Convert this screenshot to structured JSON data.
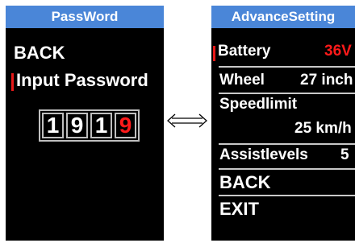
{
  "password_screen": {
    "title": "PassWord",
    "back_label": "BACK",
    "input_label": "Input Password",
    "digits": [
      "1",
      "9",
      "1",
      "9"
    ]
  },
  "connector_icon": "double-arrow-icon",
  "advance_screen": {
    "title": "AdvanceSetting",
    "battery": {
      "label": "Battery",
      "value": "36V"
    },
    "wheel": {
      "label": "Wheel",
      "value": "27",
      "unit": "inch"
    },
    "speedlimit": {
      "label": "Speedlimit",
      "value": "25",
      "unit": "km/h"
    },
    "assistlevels": {
      "label": "Assistlevels",
      "value": "5"
    },
    "back_label": "BACK",
    "exit_label": "EXIT"
  },
  "colors": {
    "title_bar": "#4a86d8",
    "highlight": "#ff1a1a",
    "screen_bg": "#000000"
  }
}
